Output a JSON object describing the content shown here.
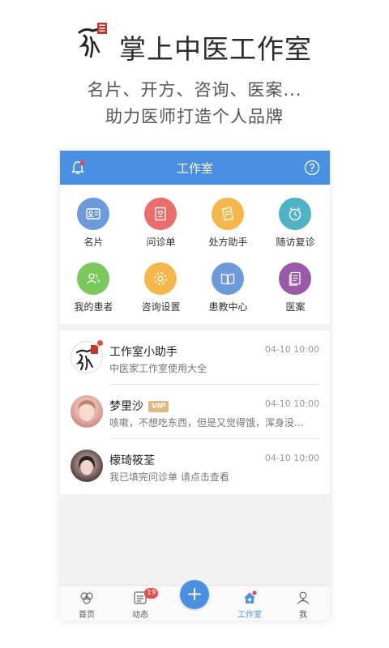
{
  "promo": {
    "title": "掌上中医工作室",
    "tagline_1": "名片、开方、咨询、医案...",
    "tagline_2": "助力医师打造个人品牌"
  },
  "topbar": {
    "title": "工作室",
    "left_icon": "bell-icon",
    "right_icon": "help-icon"
  },
  "grid": {
    "items": [
      {
        "label": "名片",
        "icon": "card-icon",
        "color": "#6c9bdc"
      },
      {
        "label": "问诊单",
        "icon": "form-icon",
        "color": "#ec6b6b"
      },
      {
        "label": "处方助手",
        "icon": "prescription-icon",
        "color": "#f5b64a"
      },
      {
        "label": "随访复诊",
        "icon": "clock-icon",
        "color": "#4fb2c5"
      },
      {
        "label": "我的患者",
        "icon": "patients-icon",
        "color": "#79c95a"
      },
      {
        "label": "咨询设置",
        "icon": "settings-icon",
        "color": "#f5b64a"
      },
      {
        "label": "患教中心",
        "icon": "book-icon",
        "color": "#6c9bdc"
      },
      {
        "label": "医案",
        "icon": "records-icon",
        "color": "#9a5aa8"
      }
    ]
  },
  "messages": [
    {
      "name": "工作室小助手",
      "vip": false,
      "text": "中医家工作室使用大全",
      "time": "04-10 10:00"
    },
    {
      "name": "梦里沙",
      "vip": true,
      "vip_label": "VIP",
      "text": "咳嗽，不想吃东西，但是又觉得饿，浑身没...",
      "time": "04-10 10:00"
    },
    {
      "name": "檬琦筱荃",
      "vip": false,
      "text": "我已填完问诊单 请点击查看",
      "time": "04-10 10:00"
    }
  ],
  "tabbar": {
    "tabs": [
      {
        "label": "首页",
        "icon": "home-icon"
      },
      {
        "label": "动态",
        "icon": "feed-icon",
        "badge": "19"
      },
      {
        "label": "",
        "icon": "plus-icon"
      },
      {
        "label": "工作室",
        "icon": "studio-icon",
        "active": true
      },
      {
        "label": "我",
        "icon": "profile-icon"
      }
    ],
    "plus_symbol": "+"
  },
  "colors": {
    "primary": "#4a90e2",
    "badge": "#e84a4a",
    "vip": "#e2b77a"
  }
}
